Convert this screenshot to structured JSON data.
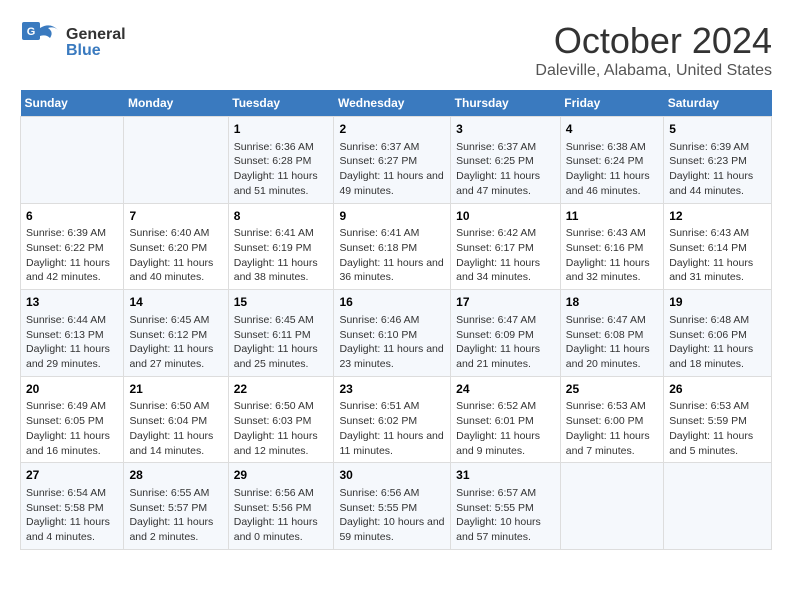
{
  "logo": {
    "general": "General",
    "blue": "Blue"
  },
  "title": {
    "month": "October 2024",
    "location": "Daleville, Alabama, United States"
  },
  "headers": [
    "Sunday",
    "Monday",
    "Tuesday",
    "Wednesday",
    "Thursday",
    "Friday",
    "Saturday"
  ],
  "weeks": [
    [
      {
        "day": "",
        "sunrise": "",
        "sunset": "",
        "daylight": ""
      },
      {
        "day": "",
        "sunrise": "",
        "sunset": "",
        "daylight": ""
      },
      {
        "day": "1",
        "sunrise": "Sunrise: 6:36 AM",
        "sunset": "Sunset: 6:28 PM",
        "daylight": "Daylight: 11 hours and 51 minutes."
      },
      {
        "day": "2",
        "sunrise": "Sunrise: 6:37 AM",
        "sunset": "Sunset: 6:27 PM",
        "daylight": "Daylight: 11 hours and 49 minutes."
      },
      {
        "day": "3",
        "sunrise": "Sunrise: 6:37 AM",
        "sunset": "Sunset: 6:25 PM",
        "daylight": "Daylight: 11 hours and 47 minutes."
      },
      {
        "day": "4",
        "sunrise": "Sunrise: 6:38 AM",
        "sunset": "Sunset: 6:24 PM",
        "daylight": "Daylight: 11 hours and 46 minutes."
      },
      {
        "day": "5",
        "sunrise": "Sunrise: 6:39 AM",
        "sunset": "Sunset: 6:23 PM",
        "daylight": "Daylight: 11 hours and 44 minutes."
      }
    ],
    [
      {
        "day": "6",
        "sunrise": "Sunrise: 6:39 AM",
        "sunset": "Sunset: 6:22 PM",
        "daylight": "Daylight: 11 hours and 42 minutes."
      },
      {
        "day": "7",
        "sunrise": "Sunrise: 6:40 AM",
        "sunset": "Sunset: 6:20 PM",
        "daylight": "Daylight: 11 hours and 40 minutes."
      },
      {
        "day": "8",
        "sunrise": "Sunrise: 6:41 AM",
        "sunset": "Sunset: 6:19 PM",
        "daylight": "Daylight: 11 hours and 38 minutes."
      },
      {
        "day": "9",
        "sunrise": "Sunrise: 6:41 AM",
        "sunset": "Sunset: 6:18 PM",
        "daylight": "Daylight: 11 hours and 36 minutes."
      },
      {
        "day": "10",
        "sunrise": "Sunrise: 6:42 AM",
        "sunset": "Sunset: 6:17 PM",
        "daylight": "Daylight: 11 hours and 34 minutes."
      },
      {
        "day": "11",
        "sunrise": "Sunrise: 6:43 AM",
        "sunset": "Sunset: 6:16 PM",
        "daylight": "Daylight: 11 hours and 32 minutes."
      },
      {
        "day": "12",
        "sunrise": "Sunrise: 6:43 AM",
        "sunset": "Sunset: 6:14 PM",
        "daylight": "Daylight: 11 hours and 31 minutes."
      }
    ],
    [
      {
        "day": "13",
        "sunrise": "Sunrise: 6:44 AM",
        "sunset": "Sunset: 6:13 PM",
        "daylight": "Daylight: 11 hours and 29 minutes."
      },
      {
        "day": "14",
        "sunrise": "Sunrise: 6:45 AM",
        "sunset": "Sunset: 6:12 PM",
        "daylight": "Daylight: 11 hours and 27 minutes."
      },
      {
        "day": "15",
        "sunrise": "Sunrise: 6:45 AM",
        "sunset": "Sunset: 6:11 PM",
        "daylight": "Daylight: 11 hours and 25 minutes."
      },
      {
        "day": "16",
        "sunrise": "Sunrise: 6:46 AM",
        "sunset": "Sunset: 6:10 PM",
        "daylight": "Daylight: 11 hours and 23 minutes."
      },
      {
        "day": "17",
        "sunrise": "Sunrise: 6:47 AM",
        "sunset": "Sunset: 6:09 PM",
        "daylight": "Daylight: 11 hours and 21 minutes."
      },
      {
        "day": "18",
        "sunrise": "Sunrise: 6:47 AM",
        "sunset": "Sunset: 6:08 PM",
        "daylight": "Daylight: 11 hours and 20 minutes."
      },
      {
        "day": "19",
        "sunrise": "Sunrise: 6:48 AM",
        "sunset": "Sunset: 6:06 PM",
        "daylight": "Daylight: 11 hours and 18 minutes."
      }
    ],
    [
      {
        "day": "20",
        "sunrise": "Sunrise: 6:49 AM",
        "sunset": "Sunset: 6:05 PM",
        "daylight": "Daylight: 11 hours and 16 minutes."
      },
      {
        "day": "21",
        "sunrise": "Sunrise: 6:50 AM",
        "sunset": "Sunset: 6:04 PM",
        "daylight": "Daylight: 11 hours and 14 minutes."
      },
      {
        "day": "22",
        "sunrise": "Sunrise: 6:50 AM",
        "sunset": "Sunset: 6:03 PM",
        "daylight": "Daylight: 11 hours and 12 minutes."
      },
      {
        "day": "23",
        "sunrise": "Sunrise: 6:51 AM",
        "sunset": "Sunset: 6:02 PM",
        "daylight": "Daylight: 11 hours and 11 minutes."
      },
      {
        "day": "24",
        "sunrise": "Sunrise: 6:52 AM",
        "sunset": "Sunset: 6:01 PM",
        "daylight": "Daylight: 11 hours and 9 minutes."
      },
      {
        "day": "25",
        "sunrise": "Sunrise: 6:53 AM",
        "sunset": "Sunset: 6:00 PM",
        "daylight": "Daylight: 11 hours and 7 minutes."
      },
      {
        "day": "26",
        "sunrise": "Sunrise: 6:53 AM",
        "sunset": "Sunset: 5:59 PM",
        "daylight": "Daylight: 11 hours and 5 minutes."
      }
    ],
    [
      {
        "day": "27",
        "sunrise": "Sunrise: 6:54 AM",
        "sunset": "Sunset: 5:58 PM",
        "daylight": "Daylight: 11 hours and 4 minutes."
      },
      {
        "day": "28",
        "sunrise": "Sunrise: 6:55 AM",
        "sunset": "Sunset: 5:57 PM",
        "daylight": "Daylight: 11 hours and 2 minutes."
      },
      {
        "day": "29",
        "sunrise": "Sunrise: 6:56 AM",
        "sunset": "Sunset: 5:56 PM",
        "daylight": "Daylight: 11 hours and 0 minutes."
      },
      {
        "day": "30",
        "sunrise": "Sunrise: 6:56 AM",
        "sunset": "Sunset: 5:55 PM",
        "daylight": "Daylight: 10 hours and 59 minutes."
      },
      {
        "day": "31",
        "sunrise": "Sunrise: 6:57 AM",
        "sunset": "Sunset: 5:55 PM",
        "daylight": "Daylight: 10 hours and 57 minutes."
      },
      {
        "day": "",
        "sunrise": "",
        "sunset": "",
        "daylight": ""
      },
      {
        "day": "",
        "sunrise": "",
        "sunset": "",
        "daylight": ""
      }
    ]
  ]
}
